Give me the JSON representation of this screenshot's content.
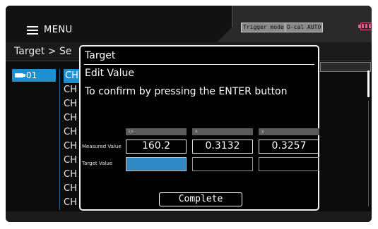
{
  "header": {
    "menu_label": "MENU",
    "trigger_badge": "Trigger mode",
    "ocal_badge": "O-cal AUTO"
  },
  "breadcrumb": "Target > Se",
  "list": {
    "selected_label": "01",
    "channels": [
      "CH",
      "CH",
      "CH",
      "CH",
      "CH",
      "CH",
      "CH",
      "CH",
      "CH",
      "CH"
    ]
  },
  "dialog": {
    "title": "Target",
    "subtitle": "Edit Value",
    "message": "To confirm by pressing the ENTER button",
    "columns": [
      "Lv",
      "x",
      "y"
    ],
    "measured_label": "Measured Value",
    "target_label": "Target Value",
    "measured_values": [
      "160.2",
      "0.3132",
      "0.3257"
    ],
    "target_values": [
      "",
      "",
      ""
    ],
    "complete_label": "Complete"
  },
  "colors": {
    "accent": "#1e8fd1",
    "battery": "#e75a8e",
    "target_active": "#2f88c4"
  }
}
